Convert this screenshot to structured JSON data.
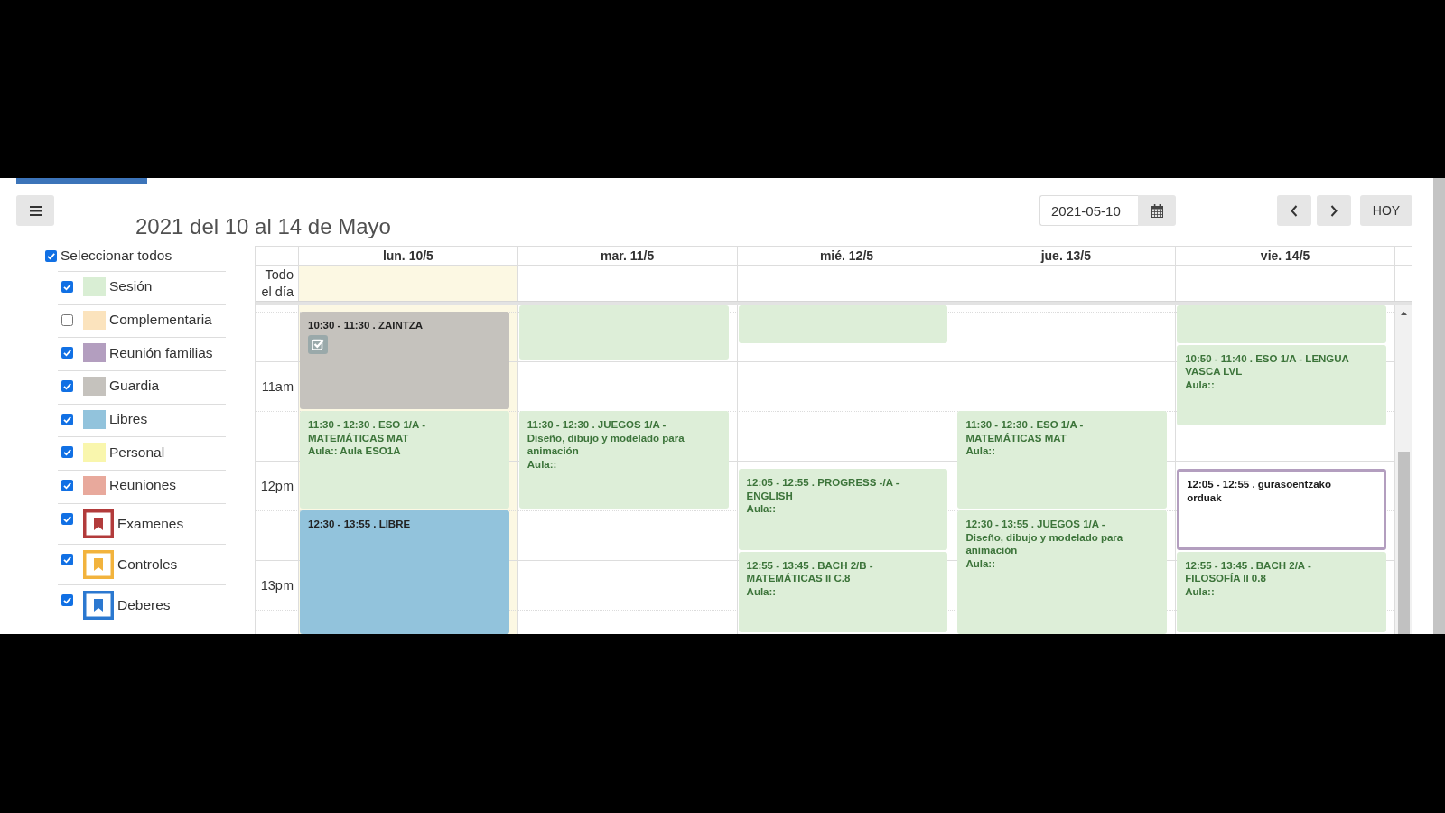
{
  "header": {
    "title": "2021 del 10 al 14 de Mayo",
    "date_field": {
      "value": "2021-05-10"
    },
    "today_button": "HOY"
  },
  "filters": {
    "select_all": {
      "label": "Seleccionar todos",
      "checked": true
    },
    "items": [
      {
        "kind": "swatch",
        "label": "Sesión",
        "checked": true,
        "color": "#d9eed4"
      },
      {
        "kind": "swatch",
        "label": "Complementaria",
        "checked": false,
        "color": "#fbe3bd"
      },
      {
        "kind": "swatch",
        "label": "Reunión familias",
        "checked": true,
        "color": "#b39ebf"
      },
      {
        "kind": "swatch",
        "label": "Guardia",
        "checked": true,
        "color": "#c5c2bd"
      },
      {
        "kind": "swatch",
        "label": "Libres",
        "checked": true,
        "color": "#92c3dc"
      },
      {
        "kind": "swatch",
        "label": "Personal",
        "checked": true,
        "color": "#f9f6ad"
      },
      {
        "kind": "swatch",
        "label": "Reuniones",
        "checked": true,
        "color": "#e8a99c"
      },
      {
        "kind": "bookmark",
        "label": "Examenes",
        "checked": true,
        "color": "#b23b3b"
      },
      {
        "kind": "bookmark",
        "label": "Controles",
        "checked": true,
        "color": "#f2b33d"
      },
      {
        "kind": "bookmark",
        "label": "Deberes",
        "checked": true,
        "color": "#2b78d0"
      }
    ]
  },
  "calendar": {
    "all_day_label": "Todo el día",
    "time_labels": [
      "11am",
      "12pm",
      "13pm"
    ],
    "days": [
      {
        "label": "lun. 10/5",
        "today": true,
        "events": [
          {
            "kind": "block",
            "heading": "10:30 - 11:30 . ZAINTZA",
            "color": "#c5c2bd",
            "checked": true
          },
          {
            "kind": "session",
            "heading": "11:30 - 12:30 . ESO 1/A - MATEMÁTICAS MAT",
            "room": "Aula:: Aula ESO1A",
            "color": "#ddeed8",
            "checked": false
          },
          {
            "kind": "block",
            "heading": "12:30 - 13:55 . LIBRE",
            "color": "#92c3dc",
            "checked": false
          }
        ]
      },
      {
        "label": "mar. 11/5",
        "today": false,
        "events": [
          {
            "kind": "session",
            "color": "#ddeed8",
            "checked": false
          },
          {
            "kind": "session",
            "heading": "11:30 - 12:30 . JUEGOS 1/A -",
            "description": "Diseño, dibujo y modelado para animación",
            "room": "Aula::",
            "color": "#ddeed8",
            "checked": false
          }
        ]
      },
      {
        "label": "mié. 12/5",
        "today": false,
        "events": [
          {
            "kind": "session",
            "color": "#ddeed8",
            "checked": false
          },
          {
            "kind": "session",
            "heading": "12:05 - 12:55 . PROGRESS -/A - ENGLISH",
            "room": "Aula::",
            "color": "#ddeed8",
            "checked": false
          },
          {
            "kind": "session",
            "heading": "12:55 - 13:45 . BACH 2/B - MATEMÁTICAS II C.8",
            "room": "Aula::",
            "color": "#ddeed8",
            "checked": false
          }
        ]
      },
      {
        "label": "jue. 13/5",
        "today": false,
        "events": [
          {
            "kind": "session",
            "heading": "11:30 - 12:30 . ESO 1/A - MATEMÁTICAS MAT",
            "room": "Aula::",
            "color": "#ddeed8",
            "checked": false
          },
          {
            "kind": "session",
            "heading": "12:30 - 13:55 . JUEGOS 1/A -",
            "description": "Diseño, dibujo y modelado para animación",
            "room": "Aula::",
            "color": "#ddeed8",
            "checked": false
          }
        ]
      },
      {
        "label": "vie. 14/5",
        "today": false,
        "events": [
          {
            "kind": "session",
            "color": "#ddeed8",
            "checked": false
          },
          {
            "kind": "session",
            "heading": "10:50 - 11:40 . ESO 1/A - LENGUA VASCA LVL",
            "room": "Aula::",
            "color": "#ddeed8",
            "checked": false
          },
          {
            "kind": "outline",
            "heading": "12:05 - 12:55 . gurasoentzako orduak",
            "color": "#b39ebf",
            "checked": false
          },
          {
            "kind": "session",
            "heading": "12:55 - 13:45 . BACH 2/A - FILOSOFÍA II 0.8",
            "room": "Aula::",
            "color": "#ddeed8",
            "checked": false
          }
        ]
      }
    ]
  }
}
